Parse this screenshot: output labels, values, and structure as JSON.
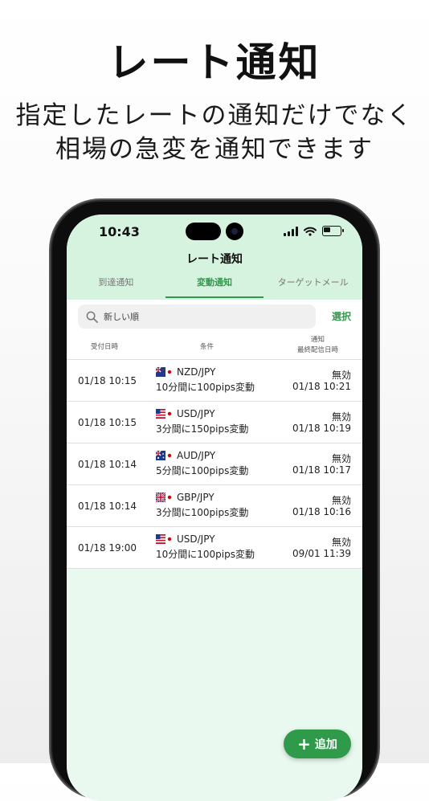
{
  "promo": {
    "headline": "レート通知",
    "subline_1": "指定したレートの通知だけでなく",
    "subline_2": "相場の急変を通知できます"
  },
  "status_bar": {
    "time": "10:43"
  },
  "nav": {
    "title": "レート通知",
    "tabs": [
      {
        "label": "到達通知",
        "active": false
      },
      {
        "label": "変動通知",
        "active": true
      },
      {
        "label": "ターゲットメール",
        "active": false
      }
    ]
  },
  "search": {
    "placeholder": "新しい順",
    "select_label": "選択"
  },
  "columns": {
    "received": "受付日時",
    "condition": "条件",
    "notify_1": "通知",
    "notify_2": "最終配信日時"
  },
  "alerts": [
    {
      "received": "01/18 10:15",
      "pair": "NZD/JPY",
      "flag": "nz-flag-icon",
      "condition": "10分間に100pips変動",
      "status": "無効",
      "last_sent": "01/18 10:21"
    },
    {
      "received": "01/18 10:15",
      "pair": "USD/JPY",
      "flag": "us-flag-icon",
      "condition": "3分間に150pips変動",
      "status": "無効",
      "last_sent": "01/18 10:19"
    },
    {
      "received": "01/18 10:14",
      "pair": "AUD/JPY",
      "flag": "au-flag-icon",
      "condition": "5分間に100pips変動",
      "status": "無効",
      "last_sent": "01/18 10:17"
    },
    {
      "received": "01/18 10:14",
      "pair": "GBP/JPY",
      "flag": "gb-flag-icon",
      "condition": "3分間に100pips変動",
      "status": "無効",
      "last_sent": "01/18 10:16"
    },
    {
      "received": "01/18 19:00",
      "pair": "USD/JPY",
      "flag": "us-flag-icon",
      "condition": "10分間に100pips変動",
      "status": "無効",
      "last_sent": "09/01 11:39"
    }
  ],
  "add_button": {
    "label": "追加"
  },
  "colors": {
    "accent": "#2f9a4a",
    "header_bg": "#d6f3df",
    "list_bg": "#eaf9ef"
  }
}
